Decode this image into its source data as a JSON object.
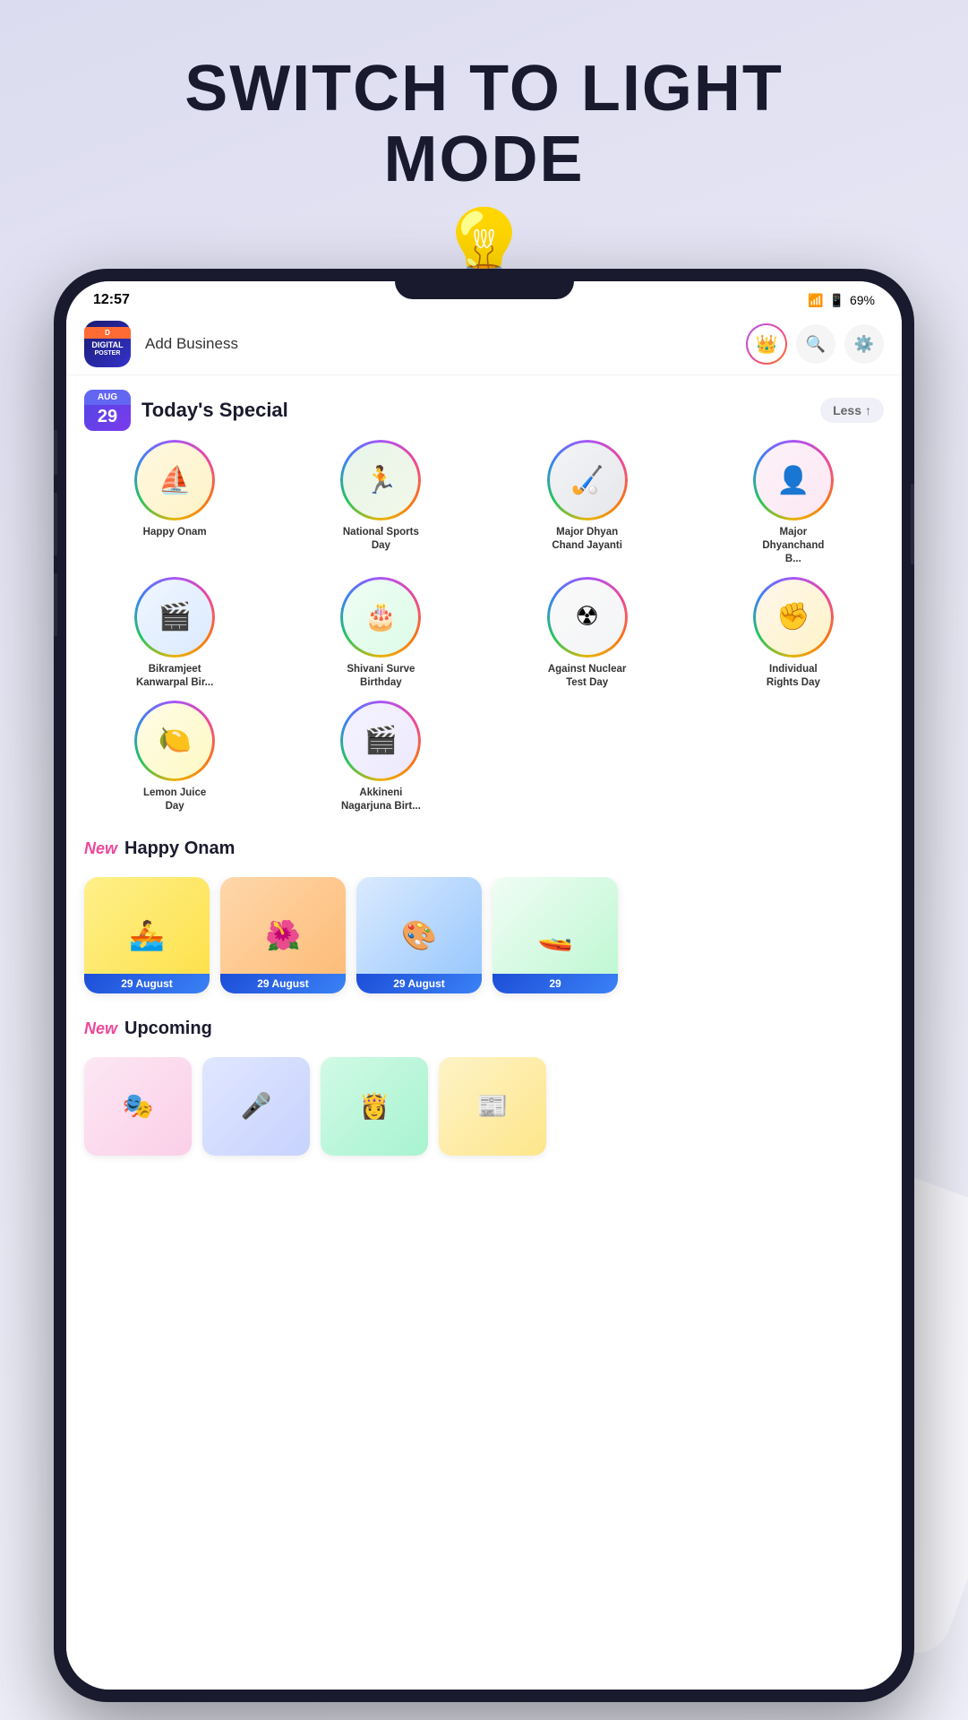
{
  "banner": {
    "line1": "SWITCH TO LIGHT",
    "line2": "MODE",
    "bulb": "💡"
  },
  "status_bar": {
    "time": "12:57",
    "wifi": "WiFi",
    "signal": "Signal",
    "battery": "69%"
  },
  "header": {
    "logo_line1": "DIGITAL",
    "logo_line2": "POSTER",
    "add_business": "Add Business",
    "crown_icon": "👑",
    "search_icon": "🔍",
    "settings_icon": "⚙"
  },
  "todays_special": {
    "date_month": "AUG",
    "date_day": "29",
    "title": "Today's Special",
    "less_btn": "Less",
    "items": [
      {
        "label": "Happy Onam",
        "emoji": "⛵",
        "bg": "onam-bg"
      },
      {
        "label": "National Sports Day",
        "emoji": "🏃",
        "bg": "sports-bg"
      },
      {
        "label": "Major Dhyan Chand Jayanti",
        "emoji": "🏑",
        "bg": "dhyan-bg"
      },
      {
        "label": "Major Dhyanchand B...",
        "emoji": "👤",
        "bg": "dhyan2-bg"
      },
      {
        "label": "Bikramjeet Kanwarpal Bir...",
        "emoji": "🎬",
        "bg": "bikram-bg"
      },
      {
        "label": "Shivani Surve Birthday",
        "emoji": "🎂",
        "bg": "shivani-bg"
      },
      {
        "label": "Against Nuclear Test Day",
        "emoji": "☢",
        "bg": "nuclear-bg"
      },
      {
        "label": "Individual Rights Day",
        "emoji": "✊",
        "bg": "rights-bg"
      },
      {
        "label": "Lemon Juice Day",
        "emoji": "🍋",
        "bg": "lemon-bg"
      },
      {
        "label": "Akkineni Nagarjuna Birt...",
        "emoji": "🎬",
        "bg": "akki-bg"
      }
    ]
  },
  "happy_onam_section": {
    "new_tag": "New",
    "title": "Happy Onam",
    "cards": [
      {
        "emoji": "🚣",
        "bg": "card-onam1",
        "date": "29 August"
      },
      {
        "emoji": "🌺",
        "bg": "card-onam2",
        "date": "29 August"
      },
      {
        "emoji": "🎨",
        "bg": "card-onam3",
        "date": "29 August"
      },
      {
        "emoji": "🚤",
        "bg": "card-onam4",
        "date": "29"
      }
    ]
  },
  "upcoming_section": {
    "new_tag": "New",
    "title": "Upcoming",
    "cards": [
      {
        "emoji": "🎭",
        "bg": "uc1"
      },
      {
        "emoji": "🎤",
        "bg": "uc2"
      },
      {
        "emoji": "👸",
        "bg": "uc3"
      },
      {
        "emoji": "📰",
        "bg": "uc4"
      }
    ]
  }
}
